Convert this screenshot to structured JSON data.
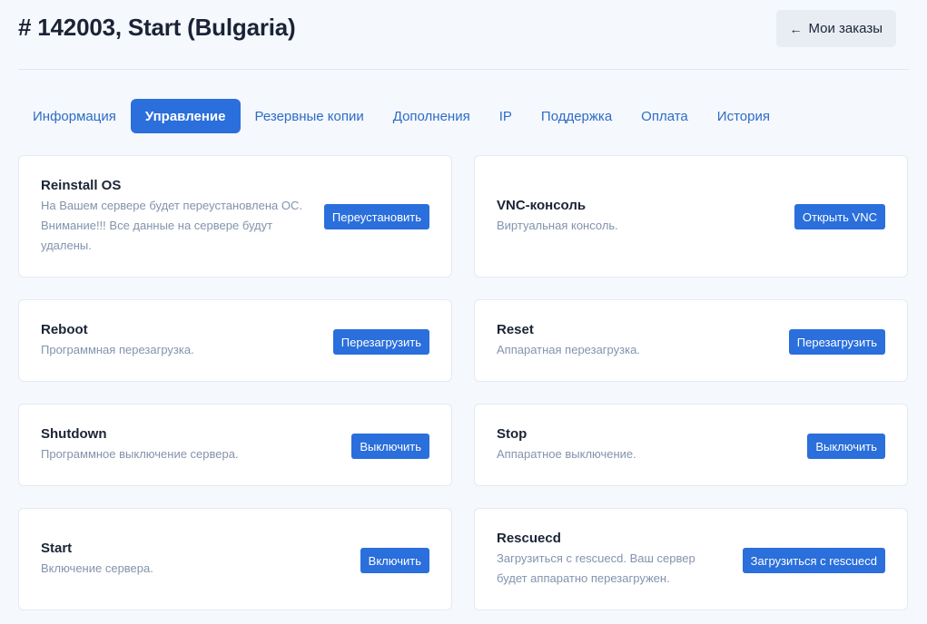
{
  "page": {
    "title": "# 142003, Start (Bulgaria)",
    "orders_button": {
      "label": "Мои заказы",
      "icon": "arrow-left-icon"
    }
  },
  "tabs": [
    {
      "label": "Информация",
      "active": false
    },
    {
      "label": "Управление",
      "active": true
    },
    {
      "label": "Резервные копии",
      "active": false
    },
    {
      "label": "Дополнения",
      "active": false
    },
    {
      "label": "IP",
      "active": false
    },
    {
      "label": "Поддержка",
      "active": false
    },
    {
      "label": "Оплата",
      "active": false
    },
    {
      "label": "История",
      "active": false
    }
  ],
  "actions": {
    "reinstall": {
      "title": "Reinstall OS",
      "description": "На Вашем сервере будет переустановлена ОС. Внимание!!! Все данные на сервере будут удалены.",
      "button": "Переустановить"
    },
    "vnc": {
      "title": "VNC-консоль",
      "description": "Виртуальная консоль.",
      "button": "Открыть VNC"
    },
    "reboot": {
      "title": "Reboot",
      "description": "Программная перезагрузка.",
      "button": "Перезагрузить"
    },
    "reset": {
      "title": "Reset",
      "description": "Аппаратная перезагрузка.",
      "button": "Перезагрузить"
    },
    "shutdown": {
      "title": "Shutdown",
      "description": "Программное выключение сервера.",
      "button": "Выключить"
    },
    "stop": {
      "title": "Stop",
      "description": "Аппаратное выключение.",
      "button": "Выключить"
    },
    "start": {
      "title": "Start",
      "description": "Включение сервера.",
      "button": "Включить"
    },
    "rescuecd": {
      "title": "Rescuecd",
      "description": "Загрузиться с rescuecd. Ваш сервер будет аппаратно перезагружен.",
      "button": "Загрузиться с rescuecd"
    }
  },
  "colors": {
    "accent": "#2a6fdb",
    "background": "#f5f8fd",
    "muted_text": "#8393ad",
    "tab_text": "#2d6cc7"
  }
}
